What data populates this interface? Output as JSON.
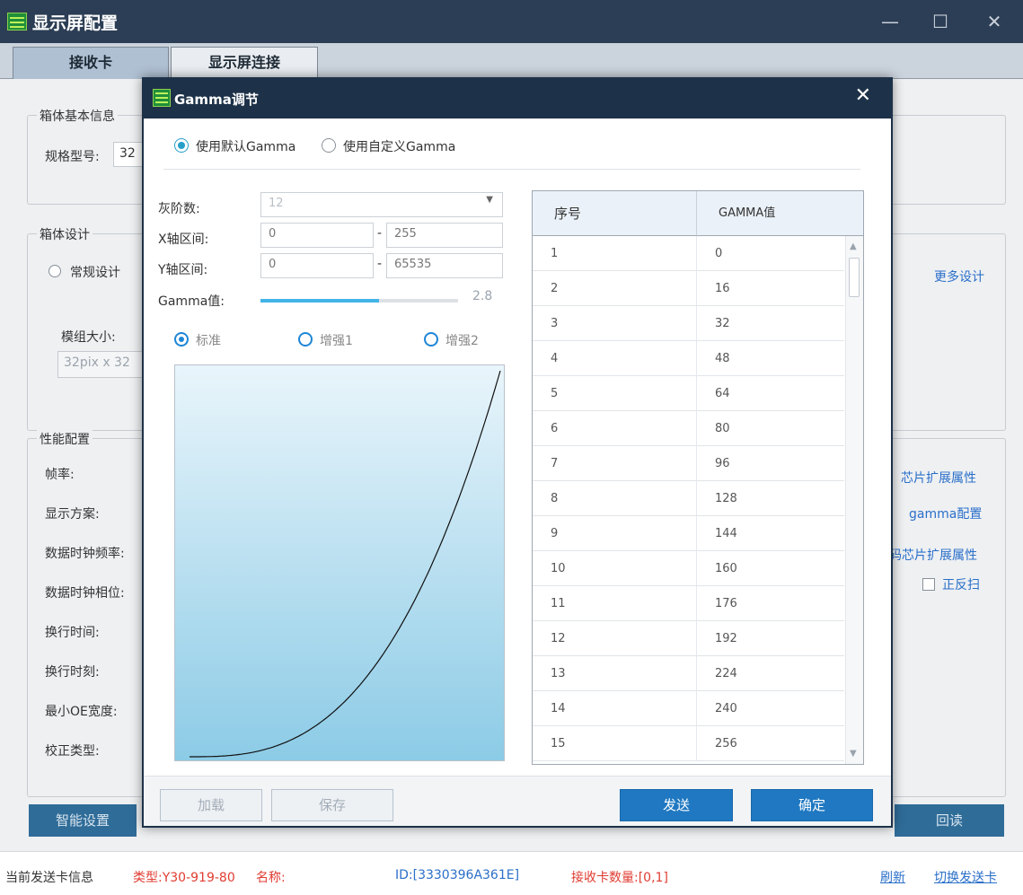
{
  "window": {
    "title": "显示屏配置"
  },
  "tabs": [
    {
      "label": "接收卡"
    },
    {
      "label": "显示屏连接"
    }
  ],
  "main": {
    "cabinet_info": {
      "title": "箱体基本信息",
      "model_label": "规格型号:",
      "model_value": "32"
    },
    "cabinet_design": {
      "title": "箱体设计",
      "normal_design": "常规设计",
      "more_design": "更多设计",
      "module_size_label": "模组大小:",
      "module_size_value": "32pix x 32"
    },
    "performance": {
      "title": "性能配置",
      "labels": [
        "帧率:",
        "显示方案:",
        "数据时钟频率:",
        "数据时钟相位:",
        "换行时间:",
        "换行时刻:",
        "最小OE宽度:",
        "校正类型:"
      ],
      "right_links": [
        "芯片扩展属性",
        "gamma配置",
        "码芯片扩展属性"
      ],
      "reverse_scan": "正反扫"
    },
    "buttons": {
      "smart_setup": "智能设置",
      "readback": "回读"
    }
  },
  "status": {
    "prefix": "当前发送卡信息",
    "type": "类型:Y30-919-80",
    "name": "名称:",
    "id": "ID:[3330396A361E]",
    "count": "接收卡数量:[0,1]",
    "refresh": "刷新",
    "switch": "切换发送卡"
  },
  "dialog": {
    "title": "Gamma调节",
    "mode_default": "使用默认Gamma",
    "mode_custom": "使用自定义Gamma",
    "gray_levels_label": "灰阶数:",
    "gray_levels_value": "12",
    "x_range_label": "X轴区间:",
    "x_min": "0",
    "x_max": "255",
    "y_range_label": "Y轴区间:",
    "y_min": "0",
    "y_max": "65535",
    "range_dash": "-",
    "gamma_label": "Gamma值:",
    "gamma_value": "2.8",
    "gamma_slider_fraction": 0.6,
    "presets": [
      "标准",
      "增强1",
      "增强2"
    ],
    "table": {
      "headers": [
        "序号",
        "GAMMA值"
      ],
      "rows": [
        [
          "1",
          "0"
        ],
        [
          "2",
          "16"
        ],
        [
          "3",
          "32"
        ],
        [
          "4",
          "48"
        ],
        [
          "5",
          "64"
        ],
        [
          "6",
          "80"
        ],
        [
          "7",
          "96"
        ],
        [
          "8",
          "128"
        ],
        [
          "9",
          "144"
        ],
        [
          "10",
          "160"
        ],
        [
          "11",
          "176"
        ],
        [
          "12",
          "192"
        ],
        [
          "13",
          "224"
        ],
        [
          "14",
          "240"
        ],
        [
          "15",
          "256"
        ]
      ]
    },
    "buttons": {
      "load": "加载",
      "save": "保存",
      "send": "发送",
      "ok": "确定"
    }
  },
  "colors": {
    "accent": "#26a0c9",
    "primary_button": "#1f78c1",
    "title_bar": "#1d3249",
    "curve_fill_top": "#e9f5fb",
    "curve_fill_bottom": "#8ccbe6",
    "status_red": "#e03c31"
  }
}
